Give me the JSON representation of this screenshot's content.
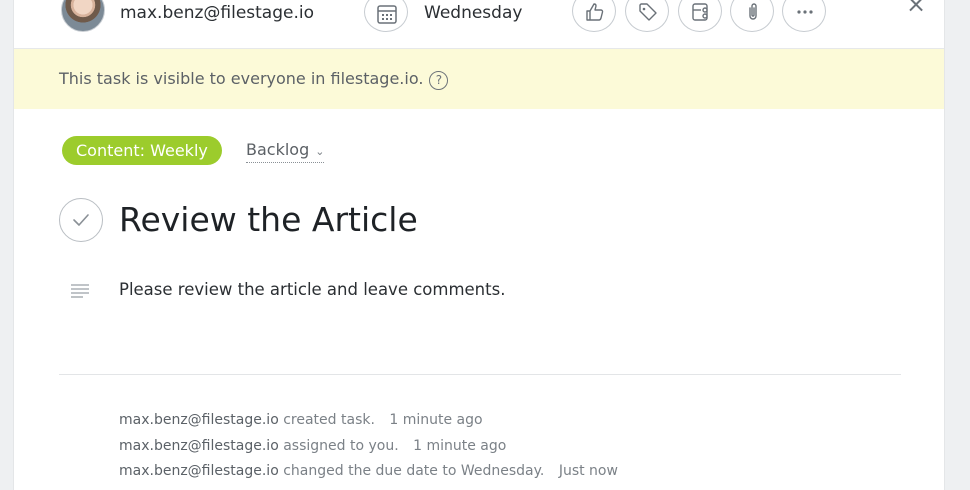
{
  "header": {
    "assignee": "max.benz@filestage.io",
    "due_date": "Wednesday",
    "icons": {
      "calendar": "calendar-icon",
      "like": "thumbs-up-icon",
      "tag": "tag-icon",
      "subtask": "subtask-icon",
      "attach": "paperclip-icon",
      "more": "more-icon",
      "close": "close-icon"
    },
    "close_glyph": "×"
  },
  "notice": {
    "text": "This task is visible to everyone in filestage.io.",
    "help_glyph": "?"
  },
  "task": {
    "project": "Content: Weekly",
    "section": "Backlog",
    "section_chevron": "⌄",
    "title": "Review the Article",
    "description": "Please review the article and leave comments."
  },
  "activity": [
    {
      "user": "max.benz@filestage.io",
      "action": "created task.",
      "time": "1 minute ago"
    },
    {
      "user": "max.benz@filestage.io",
      "action": "assigned to you.",
      "time": "1 minute ago"
    },
    {
      "user": "max.benz@filestage.io",
      "action": "changed the due date to Wednesday.",
      "time": "Just now"
    }
  ],
  "colors": {
    "project_pill": "#9ccc2c",
    "notice_bg": "#fcfad8"
  }
}
